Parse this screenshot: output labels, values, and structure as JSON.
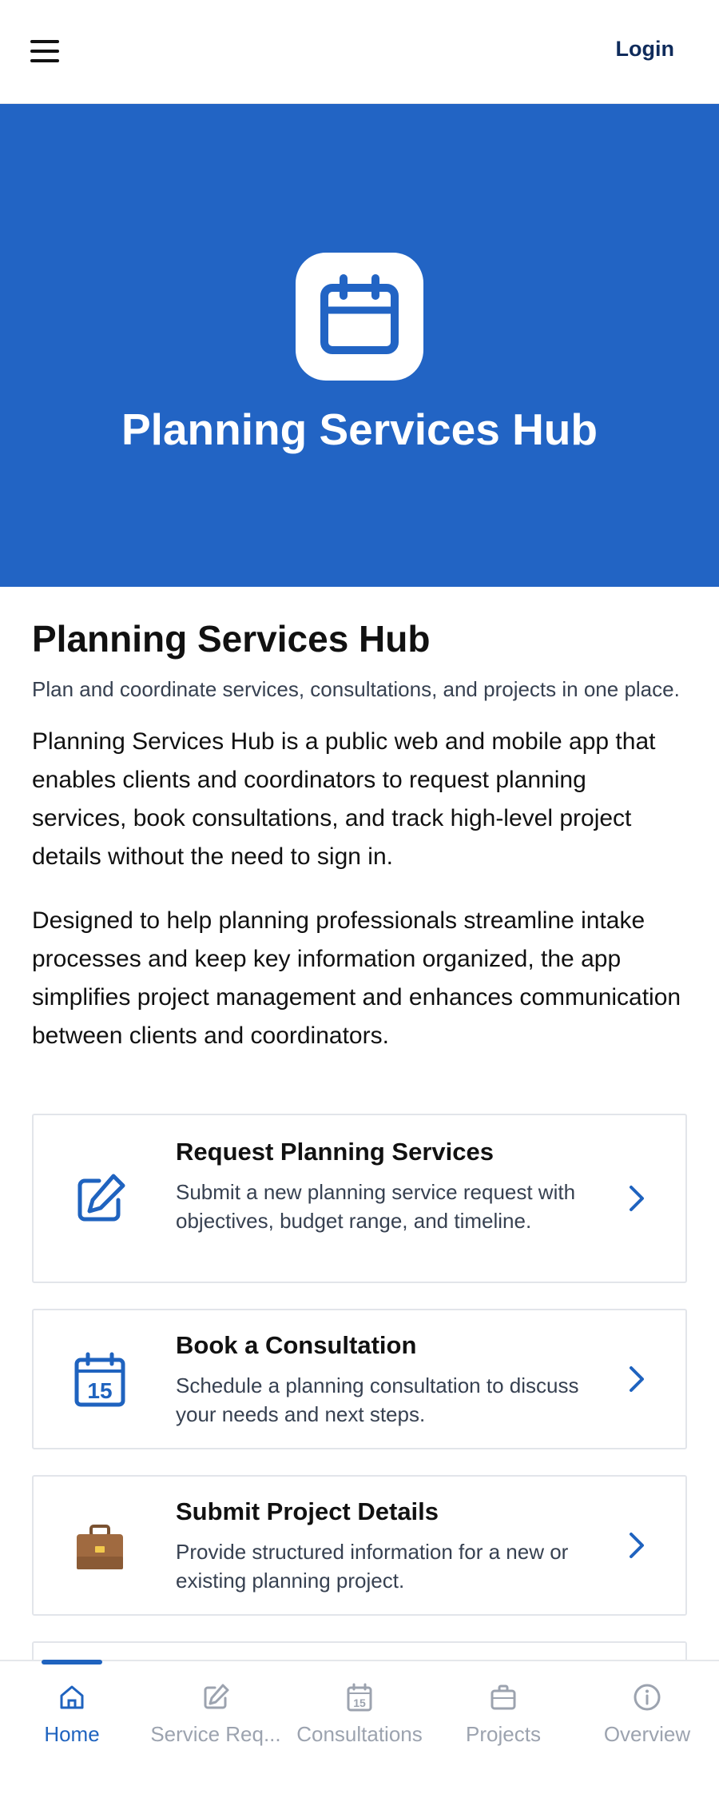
{
  "header": {
    "login_label": "Login"
  },
  "hero": {
    "title": "Planning Services Hub",
    "icon": "calendar-icon"
  },
  "main": {
    "title": "Planning Services Hub",
    "subtitle": "Plan and coordinate services, consultations, and projects in one place.",
    "paragraphs": [
      "Planning Services Hub is a public web and mobile app that enables clients and coordinators to request planning services, book consultations, and track high-level project details without the need to sign in.",
      "Designed to help planning professionals streamline intake processes and keep key information organized, the app simplifies project management and enhances communication between clients and coordinators."
    ]
  },
  "cards": [
    {
      "title": "Request Planning Services",
      "desc": "Submit a new planning service request with objectives, budget range, and timeline.",
      "icon": "edit-icon"
    },
    {
      "title": "Book a Consultation",
      "desc": "Schedule a planning consultation to discuss your needs and next steps.",
      "icon": "calendar-15-icon"
    },
    {
      "title": "Submit Project Details",
      "desc": "Provide structured information for a new or existing planning project.",
      "icon": "briefcase-icon"
    }
  ],
  "nav": [
    {
      "label": "Home",
      "icon": "home-icon",
      "active": true
    },
    {
      "label": "Service Req...",
      "icon": "edit-icon"
    },
    {
      "label": "Consultations",
      "icon": "calendar-15-icon"
    },
    {
      "label": "Projects",
      "icon": "briefcase-icon"
    },
    {
      "label": "Overview",
      "icon": "info-icon"
    }
  ],
  "colors": {
    "primary": "#2264c4",
    "active_nav": "#1f63bf",
    "inactive_nav": "#9ca3af"
  }
}
